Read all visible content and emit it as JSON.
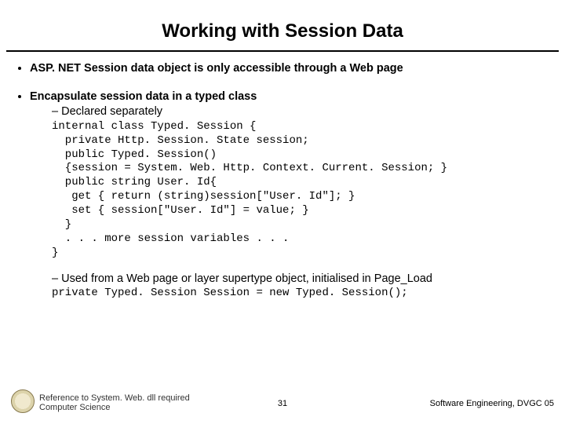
{
  "title": "Working with Session Data",
  "bullets": {
    "b1": "ASP. NET Session data object is only accessible through a Web page",
    "b2": "Encapsulate session data in a typed class",
    "b2_sub1": "Declared separately",
    "b2_sub2": "Used from a Web page or layer supertype object, initialised in Page_Load"
  },
  "code1": "internal class Typed. Session {\n  private Http. Session. State session;\n  public Typed. Session()\n  {session = System. Web. Http. Context. Current. Session; }\n  public string User. Id{\n   get { return (string)session[\"User. Id\"]; }\n   set { session[\"User. Id\"] = value; }\n  }\n  . . . more session variables . . .\n}",
  "code2": "private Typed. Session Session = new Typed. Session();",
  "footer": {
    "left_line1": "Reference to System. Web. dll required",
    "left_line2": "Computer Science",
    "center": "31",
    "right": "Software Engineering, DVGC 05"
  }
}
